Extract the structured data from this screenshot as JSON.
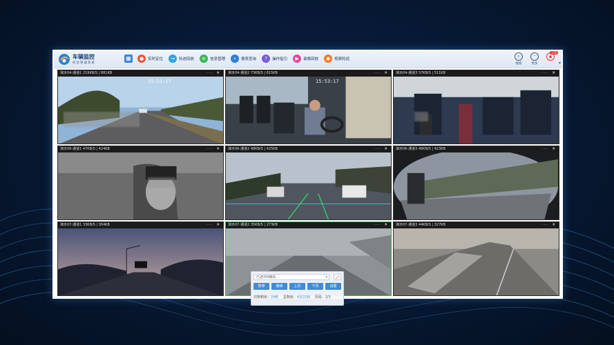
{
  "app": {
    "title": "车辆监控",
    "subtitle": "综合管理系统"
  },
  "nav": [
    {
      "label": "实时定位",
      "icon": "location-pin-icon",
      "color": "#e8563c"
    },
    {
      "label": "轨迹回放",
      "icon": "route-icon",
      "color": "#2fa3e6"
    },
    {
      "label": "信息管理",
      "icon": "document-icon",
      "color": "#3cb45a"
    },
    {
      "label": "报表查询",
      "icon": "chart-icon",
      "color": "#2e7fd8"
    },
    {
      "label": "操作指引",
      "icon": "guide-icon",
      "color": "#7a5ad6"
    },
    {
      "label": "录像回放",
      "icon": "video-replay-icon",
      "color": "#e04aa0"
    },
    {
      "label": "视频轮巡",
      "icon": "video-patrol-icon",
      "color": "#f07a2a"
    }
  ],
  "tools": {
    "search": "搜索",
    "more": "更多",
    "alarm_count": "179"
  },
  "tiles": [
    {
      "title": "演示04-通道1 219KB/S | 881KB",
      "osd": "15:53:17"
    },
    {
      "title": "演示04-通道2 73KB/S | 615KB",
      "osd": "15:53:17"
    },
    {
      "title": "演示04-通道3 57KB/S | 511KB",
      "osd": ""
    },
    {
      "title": "演示06-通道1 47KB/S | 424KB",
      "osd": ""
    },
    {
      "title": "演示06-通道2 48KB/S | 425KB",
      "osd": ""
    },
    {
      "title": "演示06-通道3 46KB/S | 423KB",
      "osd": ""
    },
    {
      "title": "演示07-通道1 33KB/S | 304KB",
      "osd": ""
    },
    {
      "title": "演示07-通道2 35KB/S | 273KB",
      "osd": ""
    },
    {
      "title": "演示07-通道3 44KB/S | 327KB",
      "osd": ""
    }
  ],
  "panel": {
    "select_placeholder": "已选中N辆车",
    "buttons": [
      "暂停",
      "继续",
      "上页",
      "下页",
      "设置"
    ],
    "switch_label": "切换剩余：",
    "switch_value": "24秒",
    "total_label": "总剩余：",
    "total_value": "4分21秒",
    "page_label": "页码：",
    "page_value": "2/3"
  },
  "colors": {
    "accent": "#3e8cdb",
    "selected_border": "#3bb04a",
    "background": "#081a38"
  }
}
